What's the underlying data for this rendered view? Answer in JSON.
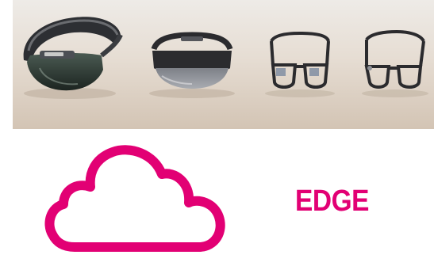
{
  "colors": {
    "brand_magenta": "#e20074",
    "photo_wall": "#ede8e4",
    "photo_table": "#d8cbbd",
    "frame_dark": "#2b2b2e"
  },
  "photo": {
    "icon": "ar-headsets-photo",
    "devices": [
      {
        "icon": "headset-visor-icon"
      },
      {
        "icon": "goggles-icon"
      },
      {
        "icon": "smart-glasses-icon"
      },
      {
        "icon": "clear-glasses-icon"
      }
    ]
  },
  "logo": {
    "icon": "cloud-icon",
    "label": "EDGE"
  }
}
